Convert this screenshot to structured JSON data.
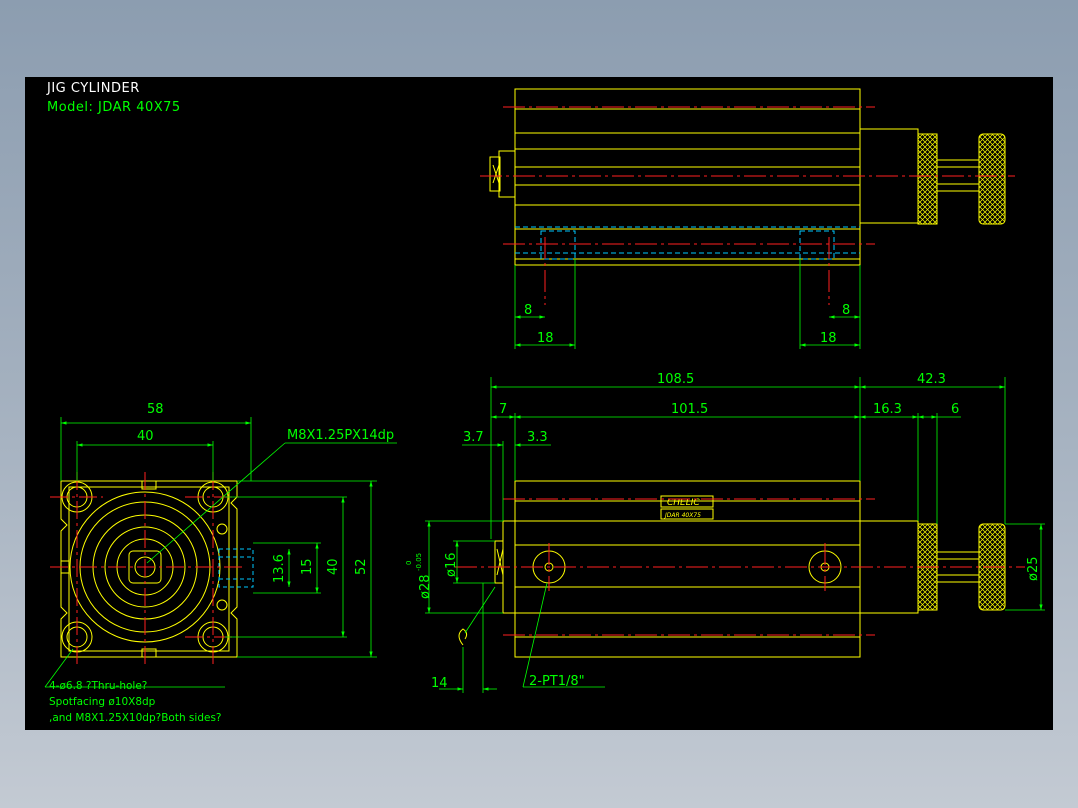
{
  "title": "JIG CYLINDER",
  "model": "Model: JDAR 40X75",
  "colors": {
    "background": "#000000",
    "outline": "#ffff00",
    "dimension": "#00ff00",
    "centerline": "#ff2020",
    "hidden": "#00c8ff",
    "text": "#ffffff"
  },
  "top_view": {
    "dims": {
      "left_small": "8",
      "left_large": "18",
      "right_small": "8",
      "right_large": "18"
    }
  },
  "front_view": {
    "dims": {
      "overall_width": "58",
      "bolt_pitch": "40",
      "port_height": "13.6",
      "port_spacing": "15",
      "bolt_vertical": "40",
      "overall_height": "52"
    },
    "thread_note": "M8X1.25PX14dp",
    "note_line1": "4-ø6.8 ?Thru-hole?",
    "note_line2": "Spotfacing ø10X8dp",
    "note_line3": ",and M8X1.25X10dp?Both sides?"
  },
  "side_view": {
    "dims": {
      "total_length": "108.5",
      "body_length": "101.5",
      "rod_extension": "42.3",
      "flange": "7",
      "d1": "3.7",
      "d2": "3.3",
      "knob_offset": "16.3",
      "knob_width": "6",
      "rod_dia": "ø16",
      "bore": "ø28",
      "bore_tol_upper": "0",
      "bore_tol_lower": "-0.05",
      "knob_dia": "ø25",
      "rod_end": "14"
    },
    "port_note": "2-PT1/8\"",
    "label_brand": "CHELIC",
    "label_model": "JDAR 40X75"
  }
}
